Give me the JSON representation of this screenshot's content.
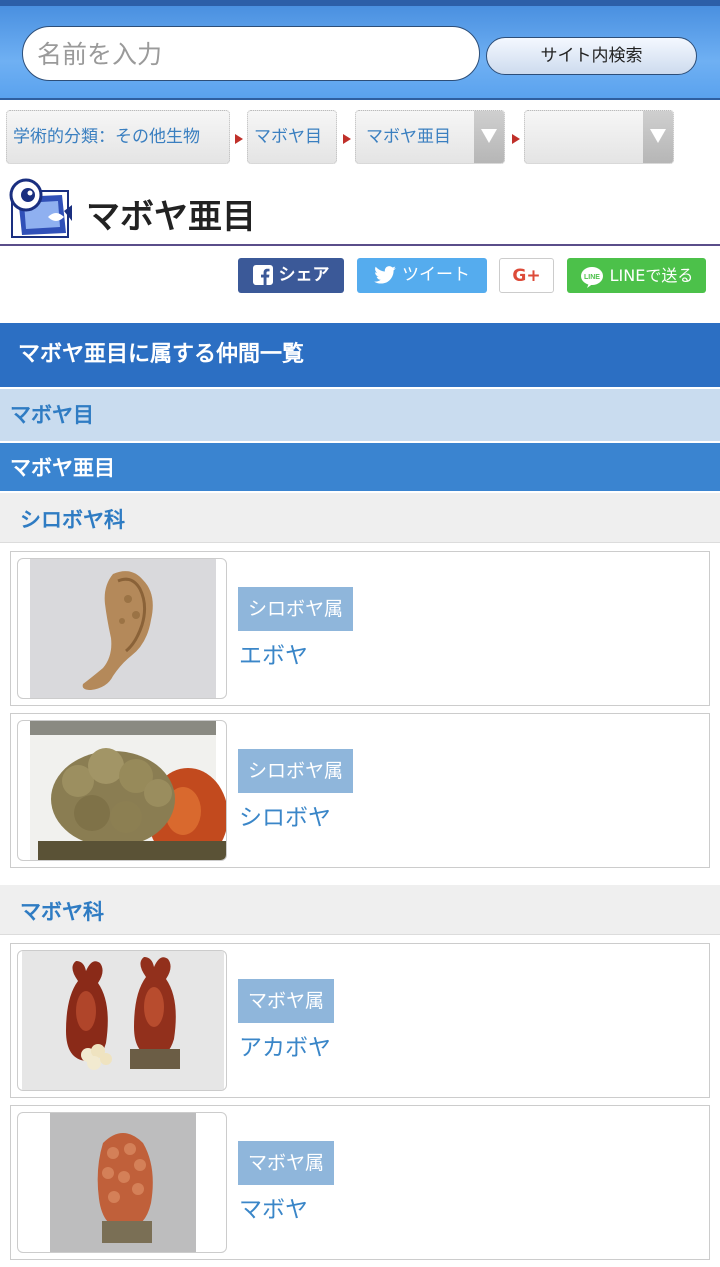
{
  "search": {
    "placeholder": "名前を入力",
    "button_label": "サイト内検索"
  },
  "breadcrumb": [
    {
      "label": "学術的分類：その他生物"
    },
    {
      "label": "マボヤ目"
    },
    {
      "label": "マボヤ亜目"
    },
    {
      "label": ""
    }
  ],
  "page_title": "マボヤ亜目",
  "share": {
    "facebook": "シェア",
    "twitter": "ツイート",
    "google": "G+",
    "line": "LINEで送る",
    "colors": {
      "facebook": "#3b5998",
      "twitter": "#55acee",
      "line": "#4cc14a",
      "google": "#dd4b39"
    }
  },
  "sections": {
    "main_header": "マボヤ亜目に属する仲間一覧",
    "order": "マボヤ目",
    "suborder": "マボヤ亜目"
  },
  "families": [
    {
      "name": "シロボヤ科",
      "species": [
        {
          "genus": "シロボヤ属",
          "name": "エボヤ"
        },
        {
          "genus": "シロボヤ属",
          "name": "シロボヤ"
        }
      ]
    },
    {
      "name": "マボヤ科",
      "species": [
        {
          "genus": "マボヤ属",
          "name": "アカボヤ"
        },
        {
          "genus": "マボヤ属",
          "name": "マボヤ"
        }
      ]
    }
  ]
}
